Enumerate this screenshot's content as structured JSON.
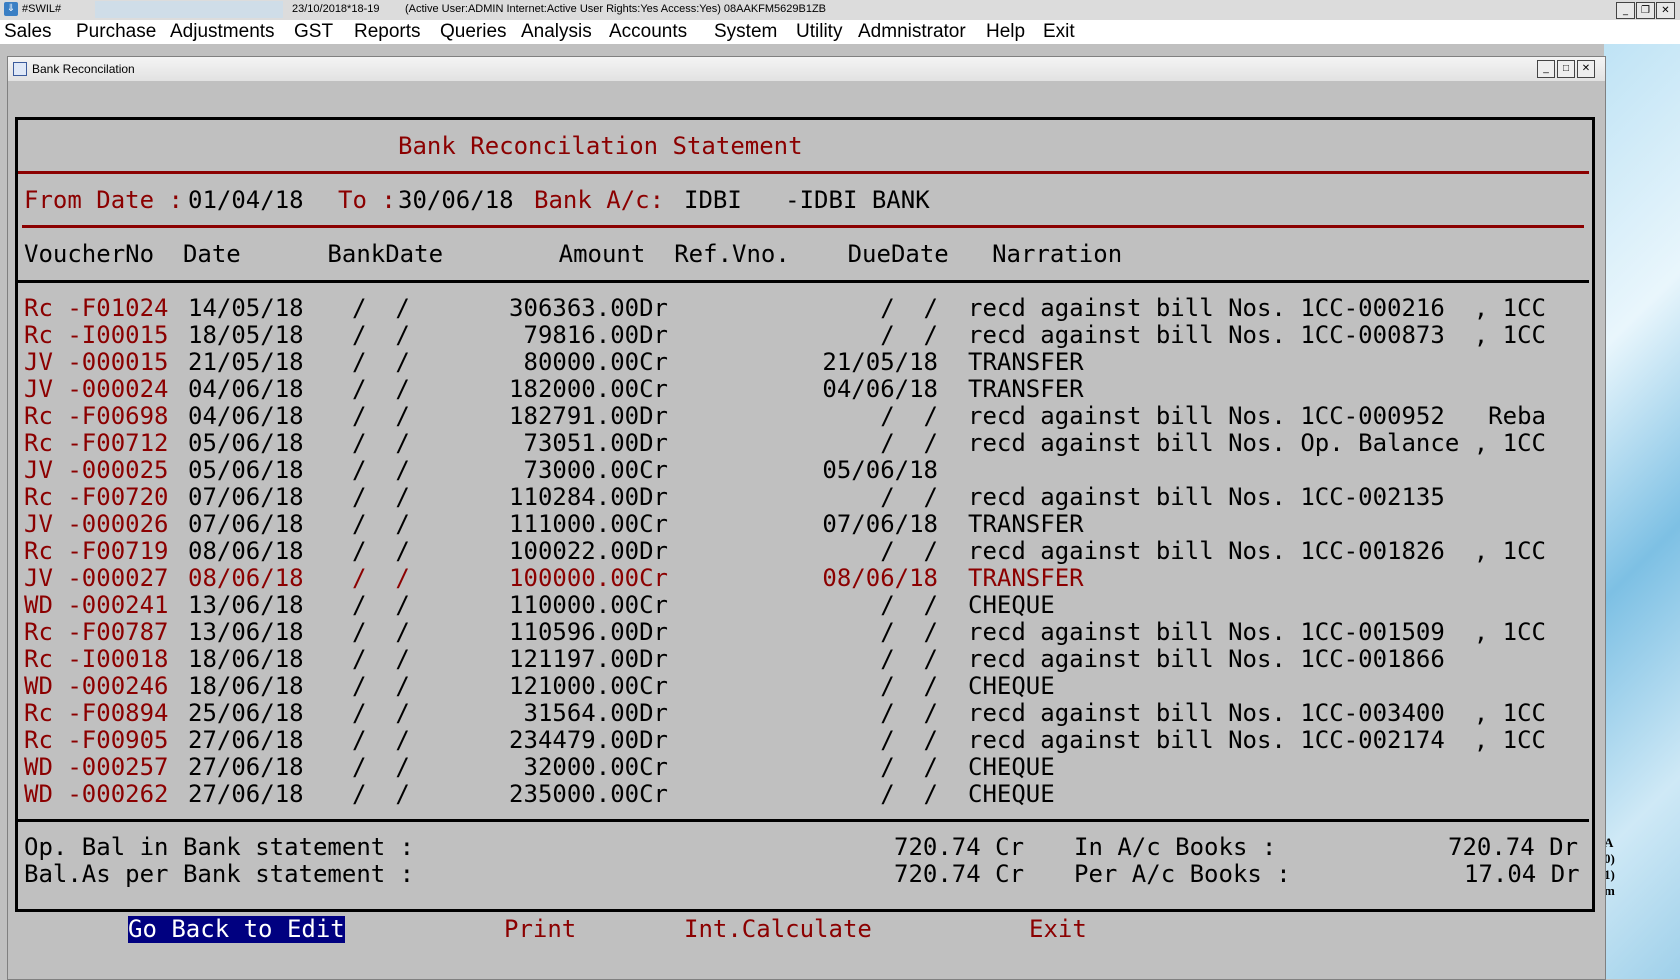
{
  "app": {
    "title": "#SWIL#",
    "date": "23/10/2018*18-19",
    "status": "(Active User:ADMIN Internet:Active  User Rights:Yes Access:Yes) 08AAKFM5629B1ZB"
  },
  "menu": [
    "Sales",
    "Purchase",
    "Adjustments",
    "GST",
    "Reports",
    "Queries",
    "Analysis",
    "Accounts",
    "System",
    "Utility",
    "Admnistrator",
    "Help",
    "Exit"
  ],
  "window": {
    "title": "Bank Reconcilation"
  },
  "report": {
    "heading": "Bank Reconcilation Statement",
    "from_label": "From Date :",
    "from_value": "01/04/18",
    "to_label": "To :",
    "to_value": "30/06/18",
    "bank_label": "Bank A/c:",
    "bank_value": "IDBI   -IDBI BANK",
    "columns": "VoucherNo  Date      BankDate        Amount  Ref.Vno.    DueDate   Narration",
    "rows": [
      {
        "voucher": "Rc -F01024",
        "date": "14/05/18",
        "bankdate": "/  /",
        "amount": "306363.00Dr",
        "duedate": " /  /",
        "narration": "recd against bill Nos. 1CC-000216  , 1CC"
      },
      {
        "voucher": "Rc -I00015",
        "date": "18/05/18",
        "bankdate": "/  /",
        "amount": "79816.00Dr",
        "duedate": " /  /",
        "narration": "recd against bill Nos. 1CC-000873  , 1CC"
      },
      {
        "voucher": "JV -000015",
        "date": "21/05/18",
        "bankdate": "/  /",
        "amount": "80000.00Cr",
        "duedate": "21/05/18",
        "narration": "TRANSFER"
      },
      {
        "voucher": "JV -000024",
        "date": "04/06/18",
        "bankdate": "/  /",
        "amount": "182000.00Cr",
        "duedate": "04/06/18",
        "narration": "TRANSFER"
      },
      {
        "voucher": "Rc -F00698",
        "date": "04/06/18",
        "bankdate": "/  /",
        "amount": "182791.00Dr",
        "duedate": " /  /",
        "narration": "recd against bill Nos. 1CC-000952   Reba"
      },
      {
        "voucher": "Rc -F00712",
        "date": "05/06/18",
        "bankdate": "/  /",
        "amount": "73051.00Dr",
        "duedate": " /  /",
        "narration": "recd against bill Nos. Op. Balance , 1CC"
      },
      {
        "voucher": "JV -000025",
        "date": "05/06/18",
        "bankdate": "/  /",
        "amount": "73000.00Cr",
        "duedate": "05/06/18",
        "narration": ""
      },
      {
        "voucher": "Rc -F00720",
        "date": "07/06/18",
        "bankdate": "/  /",
        "amount": "110284.00Dr",
        "duedate": " /  /",
        "narration": "recd against bill Nos. 1CC-002135"
      },
      {
        "voucher": "JV -000026",
        "date": "07/06/18",
        "bankdate": "/  /",
        "amount": "111000.00Cr",
        "duedate": "07/06/18",
        "narration": "TRANSFER"
      },
      {
        "voucher": "Rc -F00719",
        "date": "08/06/18",
        "bankdate": "/  /",
        "amount": "100022.00Dr",
        "duedate": " /  /",
        "narration": "recd against bill Nos. 1CC-001826  , 1CC"
      },
      {
        "voucher": "JV -000027",
        "date": "08/06/18",
        "bankdate": "/  /",
        "amount": "100000.00Cr",
        "duedate": "08/06/18",
        "narration": "TRANSFER",
        "selected": true
      },
      {
        "voucher": "WD -000241",
        "date": "13/06/18",
        "bankdate": "/  /",
        "amount": "110000.00Cr",
        "duedate": " /  /",
        "narration": "CHEQUE"
      },
      {
        "voucher": "Rc -F00787",
        "date": "13/06/18",
        "bankdate": "/  /",
        "amount": "110596.00Dr",
        "duedate": " /  /",
        "narration": "recd against bill Nos. 1CC-001509  , 1CC"
      },
      {
        "voucher": "Rc -I00018",
        "date": "18/06/18",
        "bankdate": "/  /",
        "amount": "121197.00Dr",
        "duedate": " /  /",
        "narration": "recd against bill Nos. 1CC-001866"
      },
      {
        "voucher": "WD -000246",
        "date": "18/06/18",
        "bankdate": "/  /",
        "amount": "121000.00Cr",
        "duedate": " /  /",
        "narration": "CHEQUE"
      },
      {
        "voucher": "Rc -F00894",
        "date": "25/06/18",
        "bankdate": "/  /",
        "amount": "31564.00Dr",
        "duedate": " /  /",
        "narration": "recd against bill Nos. 1CC-003400  , 1CC"
      },
      {
        "voucher": "Rc -F00905",
        "date": "27/06/18",
        "bankdate": "/  /",
        "amount": "234479.00Dr",
        "duedate": " /  /",
        "narration": "recd against bill Nos. 1CC-002174  , 1CC"
      },
      {
        "voucher": "WD -000257",
        "date": "27/06/18",
        "bankdate": "/  /",
        "amount": "32000.00Cr",
        "duedate": " /  /",
        "narration": "CHEQUE"
      },
      {
        "voucher": "WD -000262",
        "date": "27/06/18",
        "bankdate": "/  /",
        "amount": "235000.00Cr",
        "duedate": " /  /",
        "narration": "CHEQUE"
      }
    ],
    "summary": {
      "op_bal_label": "Op. Bal in Bank statement :",
      "op_bal_value": "720.74 Cr",
      "in_books_label": "In A/c Books :",
      "in_books_value": "720.74 Dr",
      "bal_label": "Bal.As per Bank statement :",
      "bal_value": "720.74 Cr",
      "per_books_label": "Per A/c Books :",
      "per_books_value": "17.04 Dr"
    }
  },
  "actions": {
    "go_back": "Go Back to Edit",
    "print": "Print",
    "int_calculate": "Int.Calculate",
    "exit": "Exit"
  },
  "desktop_fragment": "A\n0)\n1)\nm",
  "colors": {
    "text_red": "#8b0000",
    "selection_blue": "#000080",
    "background": "#c0c0c0"
  }
}
